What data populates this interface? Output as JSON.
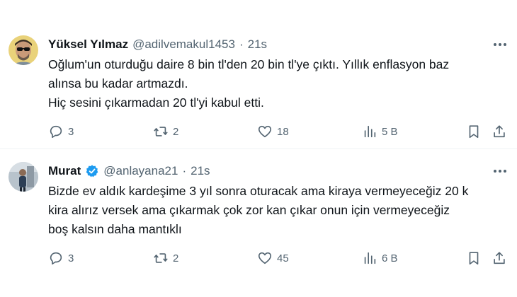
{
  "tweets": [
    {
      "name": "Yüksel Yılmaz",
      "handle": "@adilvemakul1453",
      "separator": "·",
      "time": "21s",
      "verified": false,
      "lines": [
        "Oğlum'un oturduğu daire 8 bin tl'den 20 bin tl'ye çıktı. Yıllık enflasyon baz",
        "alınsa bu kadar artmazdı.",
        "Hiç sesini çıkarmadan 20 tl'yi kabul etti."
      ],
      "replies": "3",
      "reposts": "2",
      "likes": "18",
      "views": "5 B",
      "icons": [
        "avatar",
        "more-icon",
        "reply-icon",
        "repost-icon",
        "like-icon",
        "views-icon",
        "bookmark-icon",
        "share-icon"
      ]
    },
    {
      "name": "Murat",
      "handle": "@anlayana21",
      "separator": "·",
      "time": "21s",
      "verified": true,
      "lines": [
        "Bizde ev aldık kardeşime 3 yıl sonra oturacak ama kiraya vermeyeceğiz 20 k",
        "kira alırız versek ama çıkarmak çok zor kan çıkar onun için vermeyeceğiz",
        "boş kalsın daha mantıklı"
      ],
      "replies": "3",
      "reposts": "2",
      "likes": "45",
      "views": "6 B",
      "icons": [
        "avatar",
        "verified-badge-icon",
        "more-icon",
        "reply-icon",
        "repost-icon",
        "like-icon",
        "views-icon",
        "bookmark-icon",
        "share-icon"
      ]
    }
  ],
  "colors": {
    "text": "#0f1419",
    "secondary": "#536471",
    "verified": "#1d9bf0",
    "divider": "#eff3f4"
  }
}
